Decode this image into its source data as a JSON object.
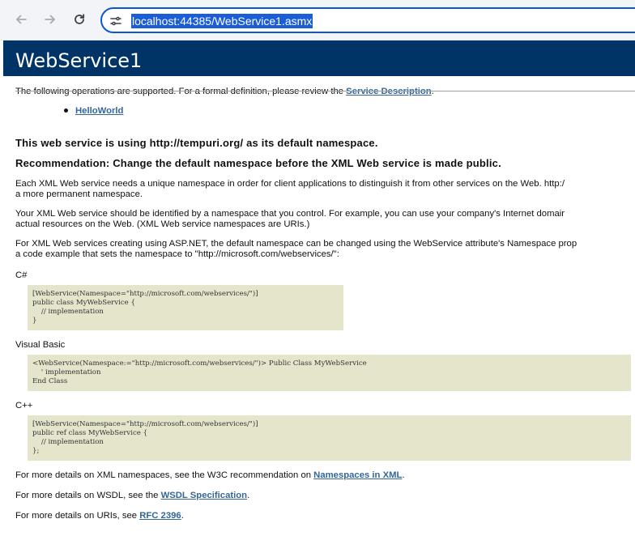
{
  "browser": {
    "url": "localhost:44385/WebService1.asmx"
  },
  "page": {
    "title": "WebService1",
    "intro_text": "The following operations are supported. For a formal definition, please review the ",
    "intro_link": "Service Description",
    "intro_end": ".",
    "operations": [
      "HelloWorld"
    ],
    "namespace_notice": "This web service is using http://tempuri.org/ as its default namespace.",
    "recommendation": "Recommendation: Change the default namespace before the XML Web service is made public.",
    "para1_line1": "Each XML Web service needs a unique namespace in order for client applications to distinguish it from other services on the Web. http:/",
    "para1_line2": "a more permanent namespace.",
    "para2_line1": "Your XML Web service should be identified by a namespace that you control. For example, you can use your company's Internet domair",
    "para2_line2": "actual resources on the Web. (XML Web service namespaces are URIs.)",
    "para3_line1": "For XML Web services creating using ASP.NET, the default namespace can be changed using the WebService attribute's Namespace prop",
    "para3_line2": "a code example that sets the namespace to \"http://microsoft.com/webservices/\":",
    "lang_csharp": "C#",
    "code_csharp": "[WebService(Namespace=\"http://microsoft.com/webservices/\")]\npublic class MyWebService {\n    // implementation\n}",
    "lang_vb": "Visual Basic",
    "code_vb": "<WebService(Namespace:=\"http://microsoft.com/webservices/\")> Public Class MyWebService\n    ' implementation\nEnd Class",
    "lang_cpp": "C++",
    "code_cpp": "[WebService(Namespace=\"http://microsoft.com/webservices/\")]\npublic ref class MyWebService {\n    // implementation\n};",
    "foot1_text": "For more details on XML namespaces, see the W3C recommendation on ",
    "foot1_link": "Namespaces in XML",
    "foot2_text": "For more details on WSDL, see the ",
    "foot2_link": "WSDL Specification",
    "foot3_text": "For more details on URIs, see ",
    "foot3_link": "RFC 2396",
    "period": "."
  }
}
